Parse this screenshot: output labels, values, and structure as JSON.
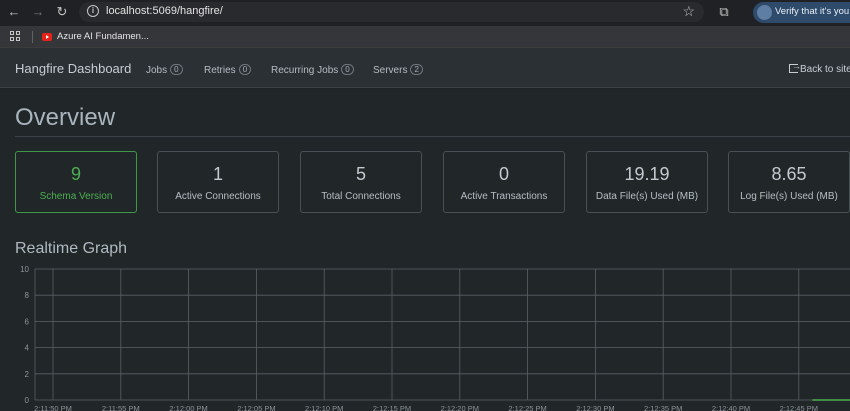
{
  "browser": {
    "url": "localhost:5069/hangfire/",
    "verify_label": "Verify that it's you",
    "bookmark": "Azure AI Fundamen..."
  },
  "nav": {
    "brand": "Hangfire Dashboard",
    "items": [
      {
        "label": "Jobs",
        "count": "0"
      },
      {
        "label": "Retries",
        "count": "0"
      },
      {
        "label": "Recurring Jobs",
        "count": "0"
      },
      {
        "label": "Servers",
        "count": "2"
      }
    ],
    "back": "Back to site"
  },
  "overview": {
    "title": "Overview",
    "cards": [
      {
        "value": "9",
        "label": "Schema Version"
      },
      {
        "value": "1",
        "label": "Active Connections"
      },
      {
        "value": "5",
        "label": "Total Connections"
      },
      {
        "value": "0",
        "label": "Active Transactions"
      },
      {
        "value": "19.19",
        "label": "Data File(s) Used (MB)"
      },
      {
        "value": "8.65",
        "label": "Log File(s) Used (MB)"
      }
    ]
  },
  "realtime": {
    "title": "Realtime Graph"
  },
  "chart_data": {
    "type": "line",
    "ylim": [
      0,
      10
    ],
    "y_ticks": [
      "0",
      "2",
      "4",
      "6",
      "8",
      "10"
    ],
    "x_ticks": [
      "2:11:50 PM",
      "2:11:55 PM",
      "2:12:00 PM",
      "2:12:05 PM",
      "2:12:10 PM",
      "2:12:15 PM",
      "2:12:20 PM",
      "2:12:25 PM",
      "2:12:30 PM",
      "2:12:35 PM",
      "2:12:40 PM",
      "2:12:45 PM"
    ],
    "grid": true,
    "line_color": "#4caf50",
    "series": [
      {
        "x": [
          "2:12:46 PM",
          "2:12:50 PM"
        ],
        "values": [
          0,
          0
        ]
      }
    ]
  }
}
